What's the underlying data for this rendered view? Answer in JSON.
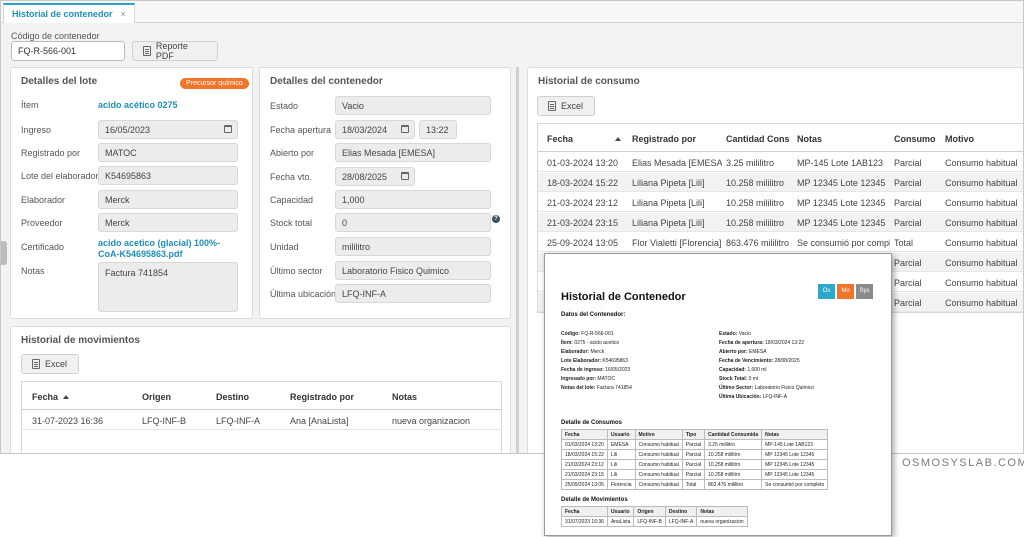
{
  "tab": {
    "label": "Historial de contenedor",
    "close": "×"
  },
  "code": {
    "label": "Código de contenedor",
    "value": "FQ-R-566-001"
  },
  "toolbar": {
    "report_label": "Reporte PDF"
  },
  "lote": {
    "title": "Detalles del lote",
    "badge": "Precursor químico",
    "item_label": "Ítem",
    "item_value": "acido acético 0275",
    "ingreso_label": "Ingreso",
    "ingreso_value": "16/05/2023",
    "registrado_label": "Registrado por",
    "registrado_value": "MATOC",
    "lote_elab_label": "Lote del elaborador",
    "lote_elab_value": "K54695863",
    "elaborador_label": "Elaborador",
    "elaborador_value": "Merck",
    "proveedor_label": "Proveedor",
    "proveedor_value": "Merck",
    "certificado_label": "Certificado",
    "certificado_value": "acido acetico (glacial) 100%- CoA-K54695863.pdf",
    "notas_label": "Notas",
    "notas_value": "Factura 741854"
  },
  "contenedor": {
    "title": "Detalles del contenedor",
    "estado_label": "Estado",
    "estado_value": "Vacio",
    "apertura_label": "Fecha apertura",
    "apertura_date": "18/03/2024",
    "apertura_time": "13:22",
    "abierto_label": "Abierto por",
    "abierto_value": "Elias Mesada [EMESA]",
    "vto_label": "Fecha vto.",
    "vto_value": "28/08/2025",
    "capacidad_label": "Capacidad",
    "capacidad_value": "1,000",
    "stock_label": "Stock total",
    "stock_value": "0",
    "unidad_label": "Unidad",
    "unidad_value": "mililitro",
    "sector_label": "Último sector",
    "sector_value": "Laboratorio Fisico Quimico",
    "ubicacion_label": "Última ubicación",
    "ubicacion_value": "LFQ-INF-A"
  },
  "movimientos": {
    "title": "Historial de movimientos",
    "excel_label": "Excel",
    "headers": [
      "Fecha",
      "Origen",
      "Destino",
      "Registrado por",
      "Notas"
    ],
    "rows": [
      [
        "31-07-2023 16:36",
        "LFQ-INF-B",
        "LFQ-INF-A",
        "Ana [AnaLista]",
        "nueva organizacion"
      ]
    ]
  },
  "consumo": {
    "title": "Historial de consumo",
    "excel_label": "Excel",
    "headers": [
      "Fecha",
      "Registrado por",
      "Cantidad Cons",
      "Notas",
      "Consumo",
      "Motivo"
    ],
    "rows": [
      [
        "01-03-2024 13:20",
        "Elias Mesada [EMESA]",
        "3.25 mililitro",
        "MP-145 Lote 1AB123",
        "Parcial",
        "Consumo habitual"
      ],
      [
        "18-03-2024 15:22",
        "Liliana Pipeta [Lili]",
        "10.258 mililitro",
        "MP 12345 Lote 12345",
        "Parcial",
        "Consumo habitual"
      ],
      [
        "21-03-2024 23:12",
        "Liliana Pipeta [Lili]",
        "10.258 mililitro",
        "MP 12345 Lote 12345",
        "Parcial",
        "Consumo habitual"
      ],
      [
        "21-03-2024 23:15",
        "Liliana Pipeta [Lili]",
        "10.258 mililitro",
        "MP 12345 Lote 12345",
        "Parcial",
        "Consumo habitual"
      ],
      [
        "25-09-2024 13:05",
        "Flor Vialetti [Florencia]",
        "863.476 mililitro",
        "Se consumió por compl",
        "Total",
        "Consumo habitual"
      ],
      [
        "",
        "",
        "",
        "",
        "Parcial",
        "Consumo habitual"
      ],
      [
        "",
        "",
        "",
        "",
        "Parcial",
        "Consumo habitual"
      ],
      [
        "",
        "",
        "",
        "",
        "Parcial",
        "Consumo habitual"
      ]
    ]
  },
  "report": {
    "title": "Historial de Contenedor",
    "logos": [
      {
        "text": "Os",
        "color": "#2aa9c9"
      },
      {
        "text": "Mo",
        "color": "#f0752a"
      },
      {
        "text": "Sys",
        "color": "#8a8a8a"
      }
    ],
    "datos_title": "Datos del Contenedor:",
    "left_kv": [
      [
        "Código:",
        "FQ-R-566-001"
      ],
      [
        "Ítem:",
        "0275 - acido acetico"
      ],
      [
        "Elaborador:",
        "Merck"
      ],
      [
        "Lote Elaborador:",
        "K54695863"
      ],
      [
        "Fecha de ingreso:",
        "16/05/2023"
      ],
      [
        "Ingresado por:",
        "MATOC"
      ],
      [
        "Notas del lote:",
        "Factura 741854"
      ]
    ],
    "right_kv": [
      [
        "Estado:",
        "Vacio"
      ],
      [
        "Fecha de apertura:",
        "18/03/2024 13:22"
      ],
      [
        "Abierto por:",
        "EMESA"
      ],
      [
        "Fecha de Vencimiento:",
        "28/08/2025"
      ],
      [
        "Capacidad:",
        "1,000 ml"
      ],
      [
        "Stock Total:",
        "0 ml"
      ],
      [
        "Último Sector:",
        "Laboratorio Fisico Quimico"
      ],
      [
        "Última Ubicación:",
        "LFQ-INF-A"
      ]
    ],
    "consumos_title": "Detalle de Consumos",
    "consumos_headers": [
      "Fecha",
      "Usuario",
      "Motivo",
      "Tipo",
      "Cantidad Consumida",
      "Notas"
    ],
    "consumos_rows": [
      [
        "01/03/2024 13:20",
        "EMESA",
        "Consumo habitual",
        "Parcial",
        "3.25 mililitro",
        "MP-145 Lote 1AB123"
      ],
      [
        "18/03/2024 15:22",
        "Lili",
        "Consumo habitual",
        "Parcial",
        "10.258 mililitro",
        "MP 12345 Lote 12345"
      ],
      [
        "21/03/2024 23:12",
        "Lili",
        "Consumo habitual",
        "Parcial",
        "10.258 mililitro",
        "MP 12345 Lote 12345"
      ],
      [
        "21/03/2024 23:15",
        "Lili",
        "Consumo habitual",
        "Parcial",
        "10.258 mililitro",
        "MP 12345 Lote 12345"
      ],
      [
        "25/09/2024 13:05",
        "Florencia",
        "Consumo habitual",
        "Total",
        "863.476 mililitro",
        "Se consumió por completo"
      ]
    ],
    "mov_title": "Detalle de Movimientos",
    "mov_headers": [
      "Fecha",
      "Usuario",
      "Origen",
      "Destino",
      "Notas"
    ],
    "mov_rows": [
      [
        "31/07/2023 16:36",
        "AnaLista",
        "LFQ-INF-B",
        "LFQ-INF-A",
        "nueva organizacion"
      ]
    ]
  },
  "watermark": "OSMOSYSLAB.COM"
}
